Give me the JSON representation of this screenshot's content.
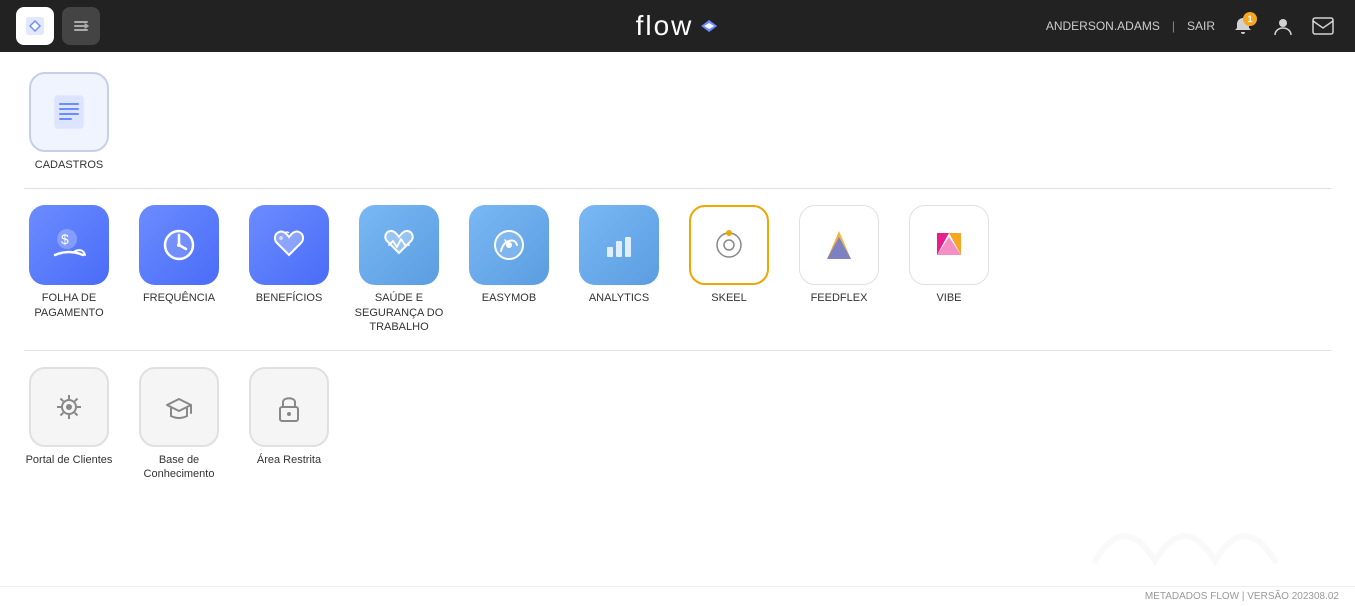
{
  "header": {
    "title": "flow",
    "user": "ANDERSON.ADAMS",
    "sair": "SAIR",
    "notif_count": "1"
  },
  "sections": {
    "cadastros": {
      "label": "CADASTROS"
    },
    "apps": {
      "label": "",
      "items": [
        {
          "id": "folha",
          "label": "FOLHA DE PAGAMENTO",
          "color": "blue"
        },
        {
          "id": "frequencia",
          "label": "FREQUÊNCIA",
          "color": "blue"
        },
        {
          "id": "beneficios",
          "label": "BENEFÍCIOS",
          "color": "blue"
        },
        {
          "id": "saude",
          "label": "SAÚDE E SEGURANÇA DO TRABALHO",
          "color": "lightblue"
        },
        {
          "id": "easymob",
          "label": "EASYMOB",
          "color": "lightblue"
        },
        {
          "id": "analytics",
          "label": "ANALYTICS",
          "color": "lightblue"
        },
        {
          "id": "skeel",
          "label": "SKEEL",
          "color": "white-orange"
        },
        {
          "id": "feedflex",
          "label": "FEEDFLEX",
          "color": "white"
        },
        {
          "id": "vibe",
          "label": "VIBE",
          "color": "white"
        }
      ]
    },
    "utilities": {
      "items": [
        {
          "id": "portal",
          "label": "Portal de Clientes"
        },
        {
          "id": "base",
          "label": "Base de Conhecimento"
        },
        {
          "id": "restrita",
          "label": "Área Restrita"
        }
      ]
    }
  },
  "footer": {
    "text": "METADADOS FLOW | VERSÃO 202308.02"
  }
}
